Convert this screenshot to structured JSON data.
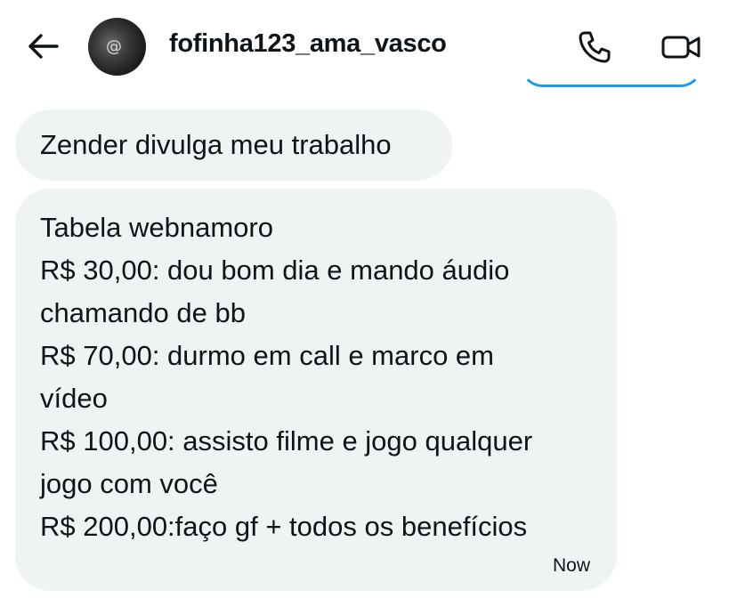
{
  "header": {
    "username": "fofinha123_ama_vasco",
    "back_icon": "arrow-left-icon",
    "call_icon": "phone-icon",
    "video_icon": "video-camera-icon",
    "avatar_glyph": "@"
  },
  "colors": {
    "bubble_bg": "#eff3f4",
    "text": "#0f1419",
    "accent": "#1d9bf0"
  },
  "messages": [
    {
      "text": "Zender divulga meu trabalho"
    },
    {
      "lines": [
        "Tabela webnamoro",
        "R$ 30,00: dou bom dia e mando áudio",
        "chamando de bb",
        "R$ 70,00: durmo em call e marco em",
        "vídeo",
        "R$ 100,00: assisto filme e jogo qualquer",
        "jogo com você",
        "R$ 200,00:faço gf + todos os benefícios"
      ],
      "timestamp": "Now"
    }
  ]
}
